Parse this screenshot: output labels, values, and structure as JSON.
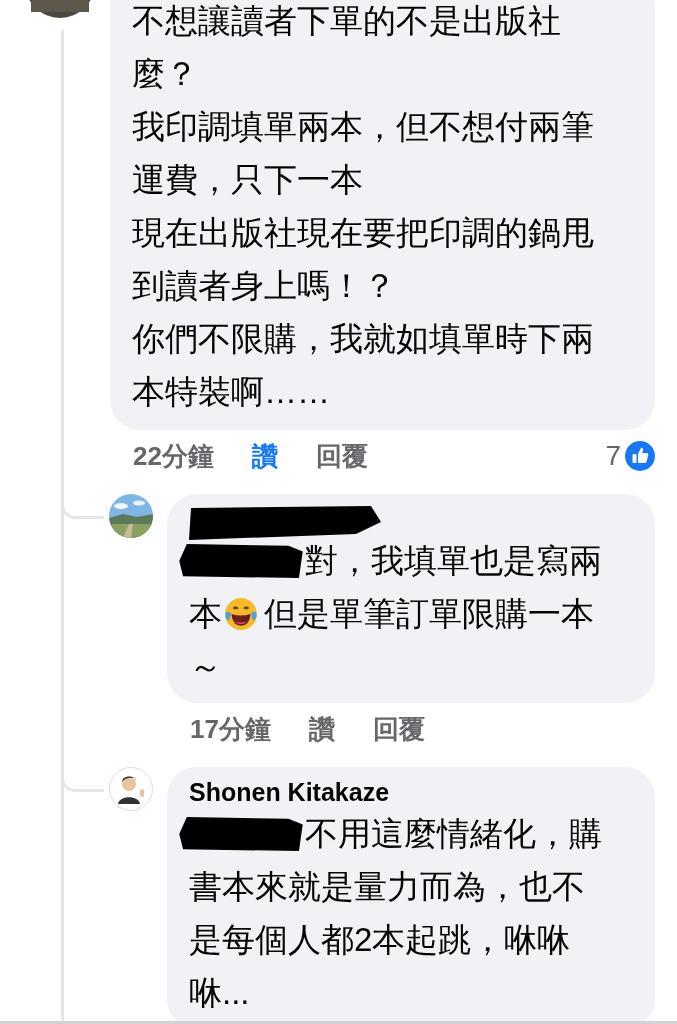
{
  "comments": [
    {
      "avatar": {
        "kind": "picture"
      },
      "lines": [
        [
          {
            "kind": "text",
            "text": "不想讓讀者下單的不是出版社"
          }
        ],
        [
          {
            "kind": "text",
            "text": "麼？"
          }
        ],
        [
          {
            "kind": "text",
            "text": "我印調填單兩本，但不想付兩筆"
          }
        ],
        [
          {
            "kind": "text",
            "text": "運費，只下一本"
          }
        ],
        [
          {
            "kind": "text",
            "text": "現在出版社現在要把印調的鍋甩"
          }
        ],
        [
          {
            "kind": "text",
            "text": "到讀者身上嗎！？"
          }
        ],
        [
          {
            "kind": "text",
            "text": "你們不限購，我就如填單時下兩"
          }
        ],
        [
          {
            "kind": "text",
            "text": "本特裝啊……"
          }
        ]
      ],
      "time": "22分鐘",
      "like_label": "讚",
      "liked": true,
      "reply_label": "回覆",
      "reaction_count": "7",
      "replies": [
        {
          "avatar": {
            "kind": "picture"
          },
          "redacted_name": true,
          "lines": [
            [
              {
                "kind": "redaction"
              },
              {
                "kind": "text",
                "text": "對，我填單也是寫兩"
              }
            ],
            [
              {
                "kind": "text",
                "text": "本"
              },
              {
                "kind": "emoji"
              },
              {
                "kind": "text",
                "text": "但是單筆訂單限購一本"
              }
            ],
            [
              {
                "kind": "text",
                "text": "～"
              }
            ]
          ],
          "time": "17分鐘",
          "like_label": "讚",
          "liked": false,
          "reply_label": "回覆"
        },
        {
          "avatar": {
            "kind": "silhouette"
          },
          "redacted_name": false,
          "name": "Shonen Kitakaze",
          "lines": [
            [
              {
                "kind": "redaction"
              },
              {
                "kind": "text",
                "text": "不用這麼情緒化，購"
              }
            ],
            [
              {
                "kind": "text",
                "text": "書本來就是量力而為，也不"
              }
            ],
            [
              {
                "kind": "text",
                "text": "是每個人都2本起跳，咻咻"
              }
            ],
            [
              {
                "kind": "text",
                "text": "咻..."
              }
            ]
          ]
        }
      ]
    }
  ]
}
